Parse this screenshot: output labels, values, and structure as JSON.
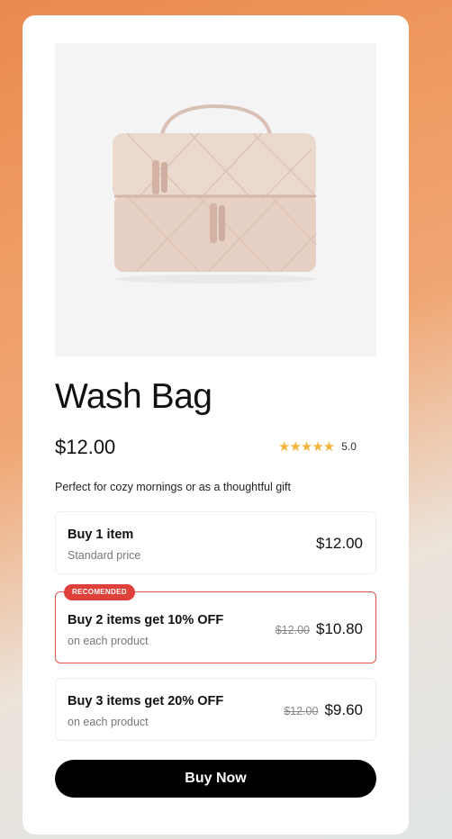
{
  "product": {
    "image_name": "wash-bag-image",
    "title": "Wash Bag",
    "price": "$12.00",
    "rating": {
      "stars": 5,
      "value": "5.0"
    },
    "tagline": "Perfect for cozy mornings or as a thoughtful gift"
  },
  "options": [
    {
      "title": "Buy 1 item",
      "subtitle": "Standard price",
      "new_price": "$12.00"
    },
    {
      "badge": "RECOMENDED",
      "title": "Buy 2 items get 10% OFF",
      "subtitle": "on each product",
      "old_price": "$12.00",
      "new_price": "$10.80"
    },
    {
      "title": "Buy 3 items get 20% OFF",
      "subtitle": "on each product",
      "old_price": "$12.00",
      "new_price": "$9.60"
    }
  ],
  "cta": {
    "label": "Buy Now"
  },
  "colors": {
    "accent": "#e0403a",
    "star": "#f3b43e",
    "button": "#000000"
  }
}
